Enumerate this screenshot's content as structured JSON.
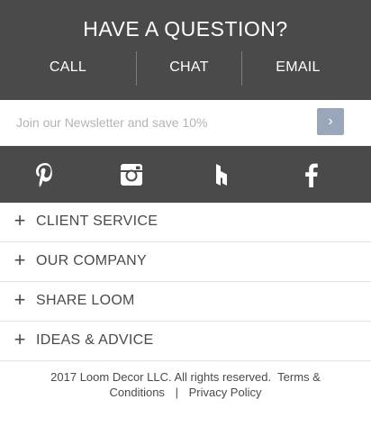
{
  "contact": {
    "title": "HAVE A QUESTION?",
    "call": "CALL",
    "chat": "CHAT",
    "email": "EMAIL"
  },
  "newsletter": {
    "placeholder": "Join our Newsletter and save 10%",
    "value": "",
    "submit_icon": "chevron-right-icon",
    "submit_glyph": "›"
  },
  "social": {
    "icons": [
      "pinterest-icon",
      "instagram-icon",
      "houzz-icon",
      "facebook-icon"
    ]
  },
  "accordion": [
    {
      "plus": "+",
      "label": "CLIENT SERVICE"
    },
    {
      "plus": "+",
      "label": "OUR COMPANY"
    },
    {
      "plus": "+",
      "label": "SHARE LOOM"
    },
    {
      "plus": "+",
      "label": "IDEAS & ADVICE"
    }
  ],
  "legal": {
    "copyright": "2017 Loom Decor LLC. All rights reserved.",
    "terms": "Terms & Conditions",
    "separator": "|",
    "privacy": "Privacy Policy"
  },
  "colors": {
    "dark_band": "#4a4a4a",
    "button": "#9aa7bb",
    "text": "#4a4a4a",
    "placeholder": "#b3b3b3"
  }
}
